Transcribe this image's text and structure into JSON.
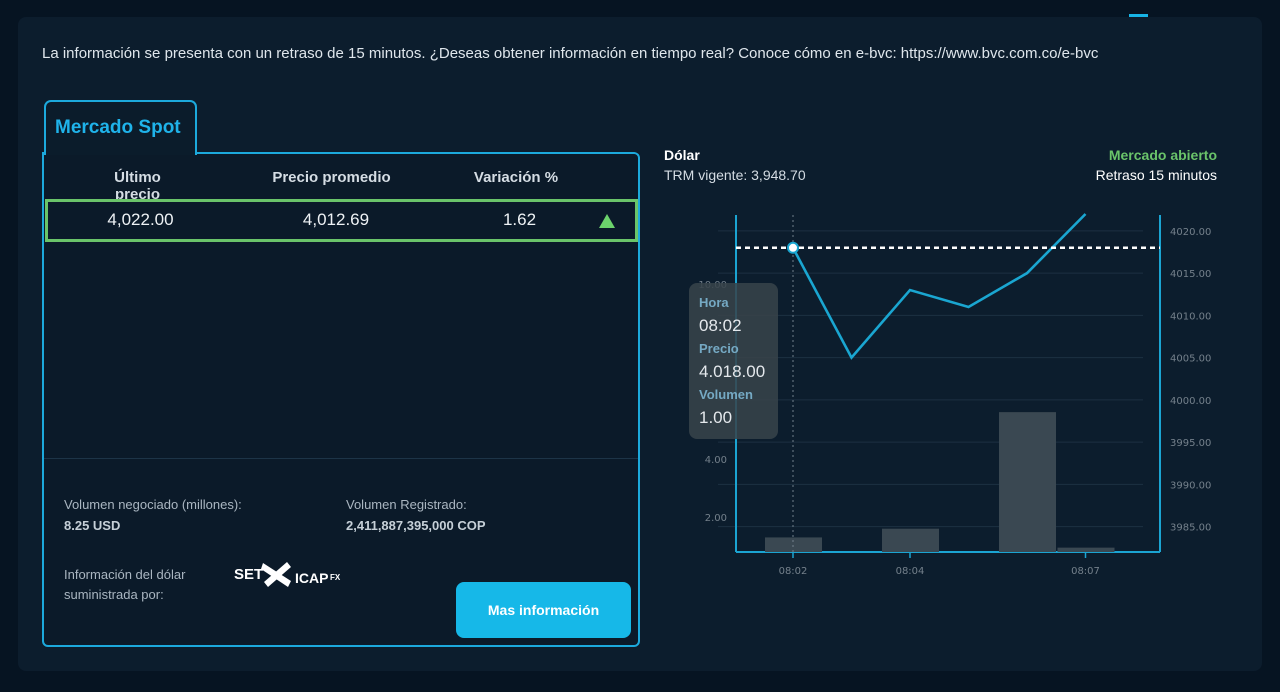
{
  "notice": "La información se presenta con un retraso de 15 minutos. ¿Deseas obtener información en tiempo real? Conoce cómo en e-bvc: https://www.bvc.com.co/e-bvc",
  "spot": {
    "tab_label": "Mercado Spot",
    "headers": [
      "Último precio",
      "Precio promedio",
      "Variación %"
    ],
    "row": {
      "ultimo": "4,022.00",
      "promedio": "4,012.69",
      "variacion": "1.62"
    },
    "trend_icon": "triangle-up-icon",
    "volume_label": "Volumen negociado (millones):",
    "volume_value": "8.25 USD",
    "registered_label": "Volumen Registrado:",
    "registered_value": "2,411,887,395,000 COP",
    "provider_label": "Información del dólar suministrada por:",
    "provider_logo": {
      "set": "SET",
      "icap": "ICAP",
      "fx": "FX"
    },
    "button_label": "Mas información"
  },
  "chart": {
    "title": "Dólar",
    "trm": "TRM vigente: 3,948.70",
    "market_status": "Mercado abierto",
    "delay": "Retraso 15 minutos",
    "tooltip": {
      "hour_label": "Hora",
      "hour": "08:02",
      "price_label": "Precio",
      "price": "4.018.00",
      "volume_label": "Volumen",
      "volume": "1.00"
    }
  },
  "colors": {
    "accent": "#16b8e8",
    "line": "#1aa6d1",
    "open": "#6ac46a",
    "bars": "#3a4852"
  },
  "chart_data": {
    "type": "line",
    "x": [
      "08:02",
      "08:03",
      "08:04",
      "08:05",
      "08:06",
      "08:07"
    ],
    "price": [
      4018,
      4005,
      4013,
      4011,
      4015,
      4022
    ],
    "volume": [
      1.3,
      0.65,
      1.6,
      0.3,
      5.6,
      0.95
    ],
    "reference_price": 4018,
    "x_tick_labels": [
      "08:02",
      "08:04",
      "08:07"
    ],
    "left_axis": {
      "ticks": [
        "2.00",
        "4.00",
        "10.00"
      ],
      "range": [
        0.8,
        12.4
      ]
    },
    "right_axis": {
      "ticks": [
        "3985.00",
        "3990.00",
        "3995.00",
        "4000.00",
        "4005.00",
        "4010.00",
        "4015.00",
        "4020.00"
      ],
      "range": [
        3982,
        4022
      ]
    },
    "grid": true
  }
}
